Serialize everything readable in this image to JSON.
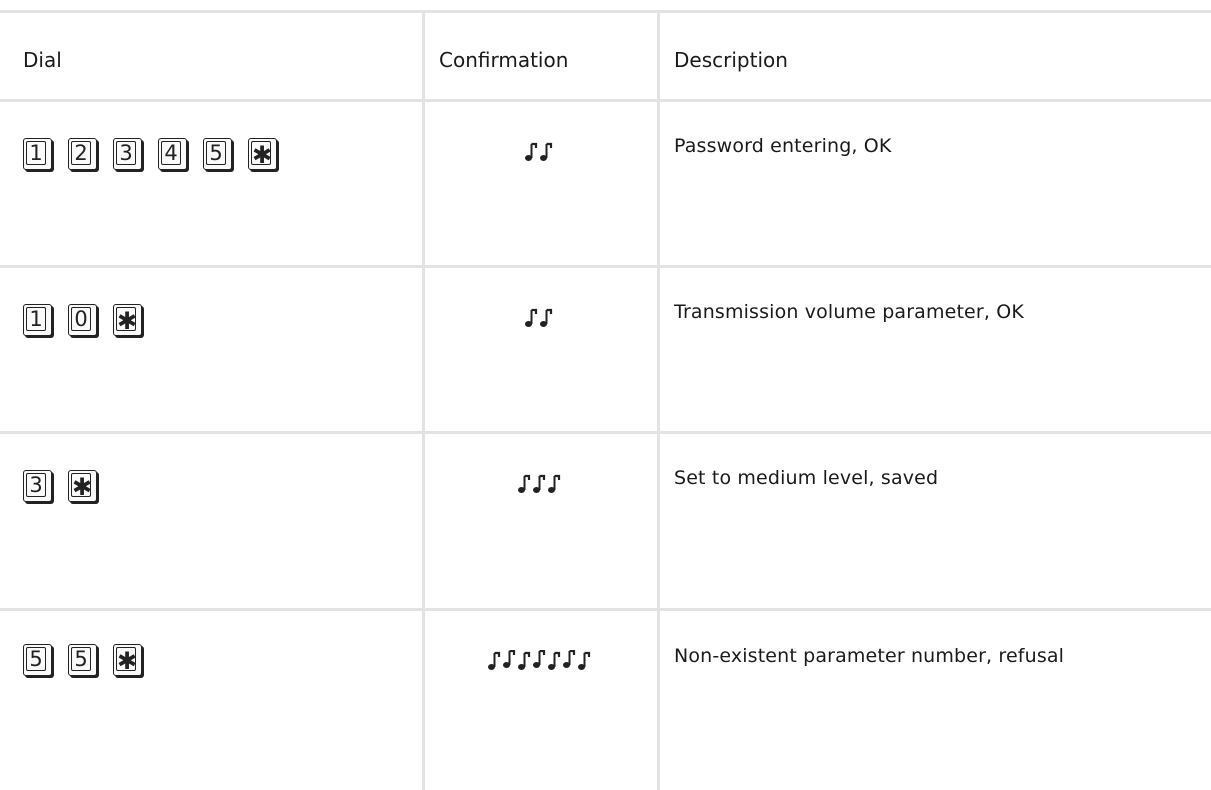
{
  "header": {
    "dial": "Dial",
    "confirmation": "Confirmation",
    "description": "Description"
  },
  "rows": [
    {
      "keys": [
        "1",
        "2",
        "3",
        "4",
        "5",
        "✱"
      ],
      "beeps": 2,
      "description": "Password entering, OK"
    },
    {
      "keys": [
        "1",
        "0",
        "✱"
      ],
      "beeps": 2,
      "description": "Transmission volume parameter, OK"
    },
    {
      "keys": [
        "3",
        "✱"
      ],
      "beeps": 3,
      "description": "Set to medium level, saved"
    },
    {
      "keys": [
        "5",
        "5",
        "✱"
      ],
      "beeps": 7,
      "description": "Non-existent parameter number, refusal"
    }
  ],
  "icons": {
    "key": "keypad-key-icon",
    "confirmation": "beep-notes-icon"
  },
  "colors": {
    "grid": "#e3e3e3",
    "text": "#1a1a1a",
    "icon": "#222222"
  }
}
